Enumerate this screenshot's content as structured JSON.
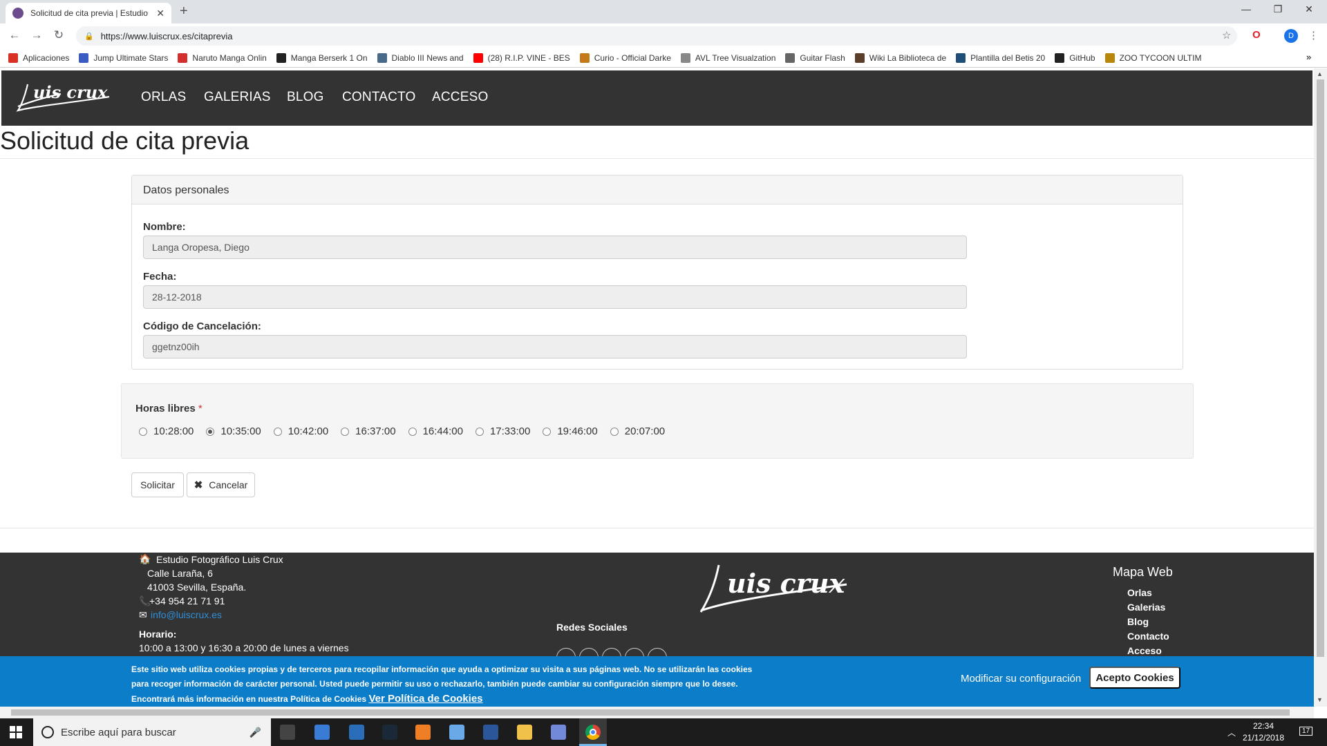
{
  "browser": {
    "tab_title": "Solicitud de cita previa | Estudio",
    "url": "https://www.luiscrux.es/citaprevia",
    "bookmarks": [
      {
        "label": "Aplicaciones",
        "color": "#d93025"
      },
      {
        "label": "Jump Ultimate Stars",
        "color": "#3a5bbf"
      },
      {
        "label": "Naruto Manga Onlin",
        "color": "#d32f2f"
      },
      {
        "label": "Manga Berserk 1 On",
        "color": "#222222"
      },
      {
        "label": "Diablo III News and",
        "color": "#4a6a8a"
      },
      {
        "label": "(28) R.I.P. VINE - BES",
        "color": "#ff0000"
      },
      {
        "label": "Curio - Official Darke",
        "color": "#c47a1a"
      },
      {
        "label": "AVL Tree Visualzation",
        "color": "#888888"
      },
      {
        "label": "Guitar Flash",
        "color": "#666666"
      },
      {
        "label": "Wiki La Biblioteca de",
        "color": "#5a3e2b"
      },
      {
        "label": "Plantilla del Betis 20",
        "color": "#1f4e79"
      },
      {
        "label": "GitHub",
        "color": "#222222"
      },
      {
        "label": "ZOO TYCOON ULTIM",
        "color": "#b8860b"
      }
    ],
    "profile_initial": "D"
  },
  "site": {
    "logo_text": "Luis crux",
    "nav": [
      "ORLAS",
      "GALERIAS",
      "BLOG",
      "CONTACTO",
      "ACCESO"
    ]
  },
  "page": {
    "title": "Solicitud de cita previa",
    "panel_title": "Datos personales",
    "fields": [
      {
        "label": "Nombre:",
        "value": "Langa Oropesa, Diego"
      },
      {
        "label": "Fecha:",
        "value": "28-12-2018"
      },
      {
        "label": "Código de Cancelación:",
        "value": "ggetnz00ih"
      }
    ],
    "horas_label": "Horas libres",
    "horas_required": "*",
    "horas": [
      "10:28:00",
      "10:35:00",
      "10:42:00",
      "16:37:00",
      "16:44:00",
      "17:33:00",
      "19:46:00",
      "20:07:00"
    ],
    "horas_selected": "10:35:00",
    "btn_solicitar": "Solicitar",
    "btn_cancelar": "Cancelar"
  },
  "footer": {
    "studio": "Estudio Fotográfico Luis Crux",
    "street": "Calle Laraña, 6",
    "city": "41003 Sevilla, España.",
    "phone": "+34 954 21 71 91",
    "email": "info@luiscrux.es",
    "horario_label": "Horario:",
    "horario": "10:00 a 13:00 y 16:30 a 20:00 de lunes a viernes",
    "redes_label": "Redes Sociales",
    "mapa_label": "Mapa Web",
    "mapa_items": [
      "Orlas",
      "Galerias",
      "Blog",
      "Contacto",
      "Acceso"
    ]
  },
  "cookie": {
    "line1": "Este sitio web utiliza cookies propias y de terceros para recopilar información que ayuda a optimizar su visita a sus páginas web. No se utilizarán las cookies",
    "line2": "para recoger información de carácter personal. Usted puede permitir su uso o rechazarlo, también puede cambiar su configuración siempre que lo desee.",
    "line3": "Encontrará más información en nuestra Política de Cookies",
    "link": "Ver Política de Cookies",
    "modify": "Modificar su configuración",
    "accept": "Acepto Cookies"
  },
  "taskbar": {
    "search_placeholder": "Escribe aquí para buscar",
    "time": "22:34",
    "date": "21/12/2018",
    "notifications": "17"
  }
}
